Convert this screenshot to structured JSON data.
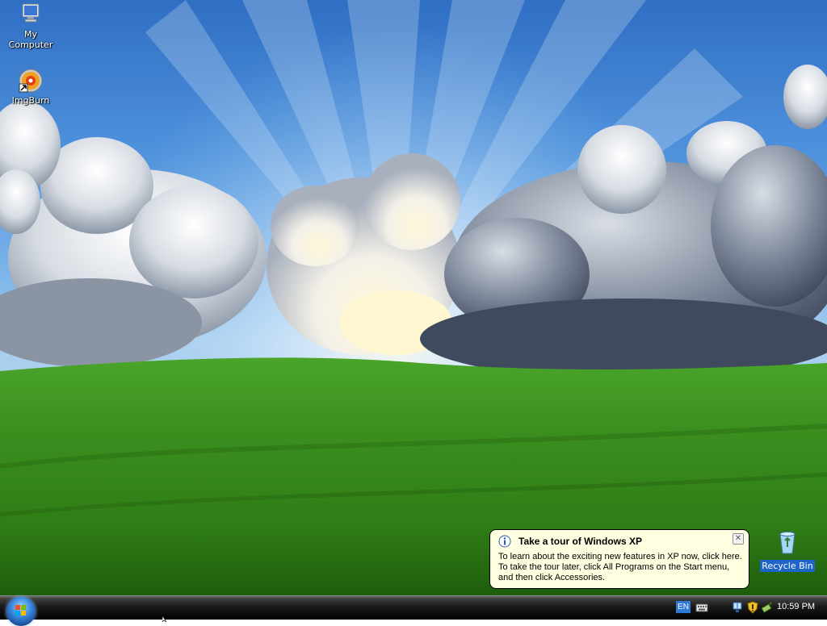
{
  "desktop": {
    "icons": [
      {
        "label": "My\nComputer",
        "icon": "my-computer-icon"
      },
      {
        "label": "ImgBurn",
        "icon": "imgburn-icon"
      },
      {
        "label": "Recycle Bin",
        "icon": "recycle-bin-icon"
      }
    ]
  },
  "balloon": {
    "title": "Take a tour of Windows XP",
    "body": "To learn about the exciting new features in XP now, click here. To take the tour later, click All Programs on the Start menu, and then click Accessories.",
    "close_glyph": "✕",
    "icon": "info-icon"
  },
  "taskbar": {
    "language": "EN",
    "clock": "10:59 PM",
    "tray_icons": [
      "keyboard-icon",
      "network-icon",
      "security-shield-icon",
      "safely-remove-hardware-icon"
    ]
  },
  "colors": {
    "taskbar": "#000000",
    "balloon_bg": "#ffffe1",
    "selection": "#1f64c8"
  }
}
